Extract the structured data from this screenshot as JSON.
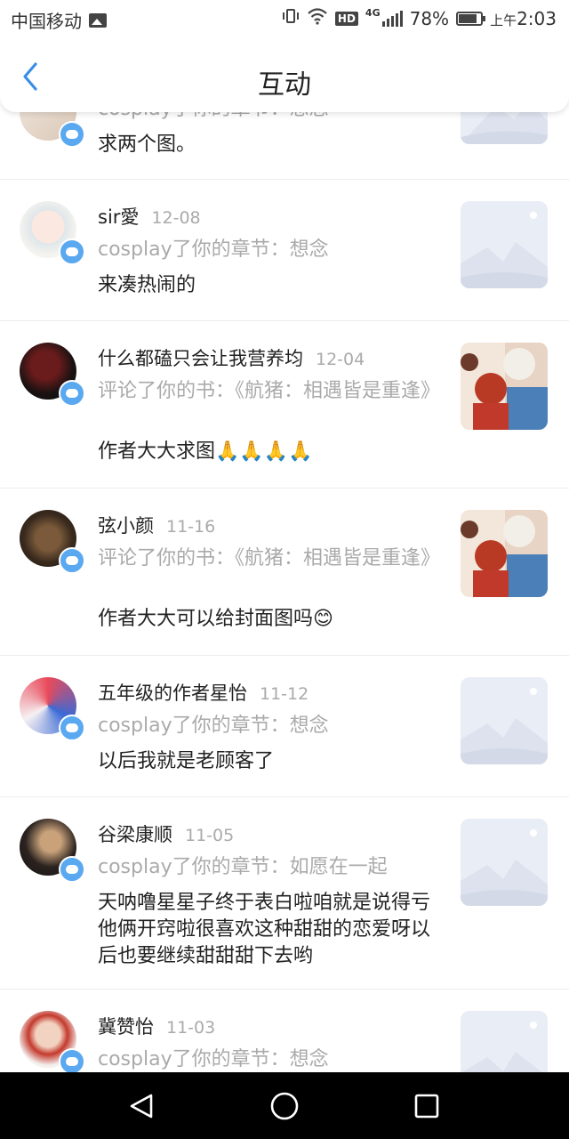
{
  "status_bar": {
    "carrier": "中国移动",
    "network": "HD",
    "network_type": "4G",
    "battery": "78%",
    "battery_level": 0.78,
    "ampm": "上午",
    "time": "2:03"
  },
  "header": {
    "title": "互动"
  },
  "items": [
    {
      "username": "",
      "date": "",
      "action": "cosplay了你的章节：想念",
      "content": "求两个图。",
      "thumb": "placeholder"
    },
    {
      "username": "sir愛",
      "date": "12-08",
      "action": "cosplay了你的章节：想念",
      "content": "来凑热闹的",
      "thumb": "placeholder"
    },
    {
      "username": "什么都磕只会让我营养均",
      "date": "12-04",
      "action": "评论了你的书：《航猪：相遇皆是重逢》",
      "content": "作者大大求图🙏🙏🙏🙏",
      "thumb": "cover"
    },
    {
      "username": "弦小颜",
      "date": "11-16",
      "action": "评论了你的书：《航猪：相遇皆是重逢》",
      "content": "作者大大可以给封面图吗😊",
      "thumb": "cover"
    },
    {
      "username": "五年级的作者星怡",
      "date": "11-12",
      "action": "cosplay了你的章节：想念",
      "content": "以后我就是老顾客了",
      "thumb": "placeholder"
    },
    {
      "username": "谷梁康顺",
      "date": "11-05",
      "action": "cosplay了你的章节：如愿在一起",
      "content": "天呐噜星星子终于表白啦咱就是说得亏他俩开窍啦很喜欢这种甜甜的恋爱呀以后也要继续甜甜甜下去哟",
      "thumb": "placeholder"
    },
    {
      "username": "冀赞怡",
      "date": "11-03",
      "action": "cosplay了你的章节：想念",
      "content": "",
      "thumb": "placeholder"
    }
  ],
  "colors": {
    "accent": "#3a8ee6",
    "badge": "#5aa9f0",
    "meta": "#aaaaaa"
  },
  "icons": {
    "back": "chevron-left-icon",
    "nav_back": "triangle-back-icon",
    "nav_home": "circle-home-icon",
    "nav_recent": "square-recent-icon"
  }
}
